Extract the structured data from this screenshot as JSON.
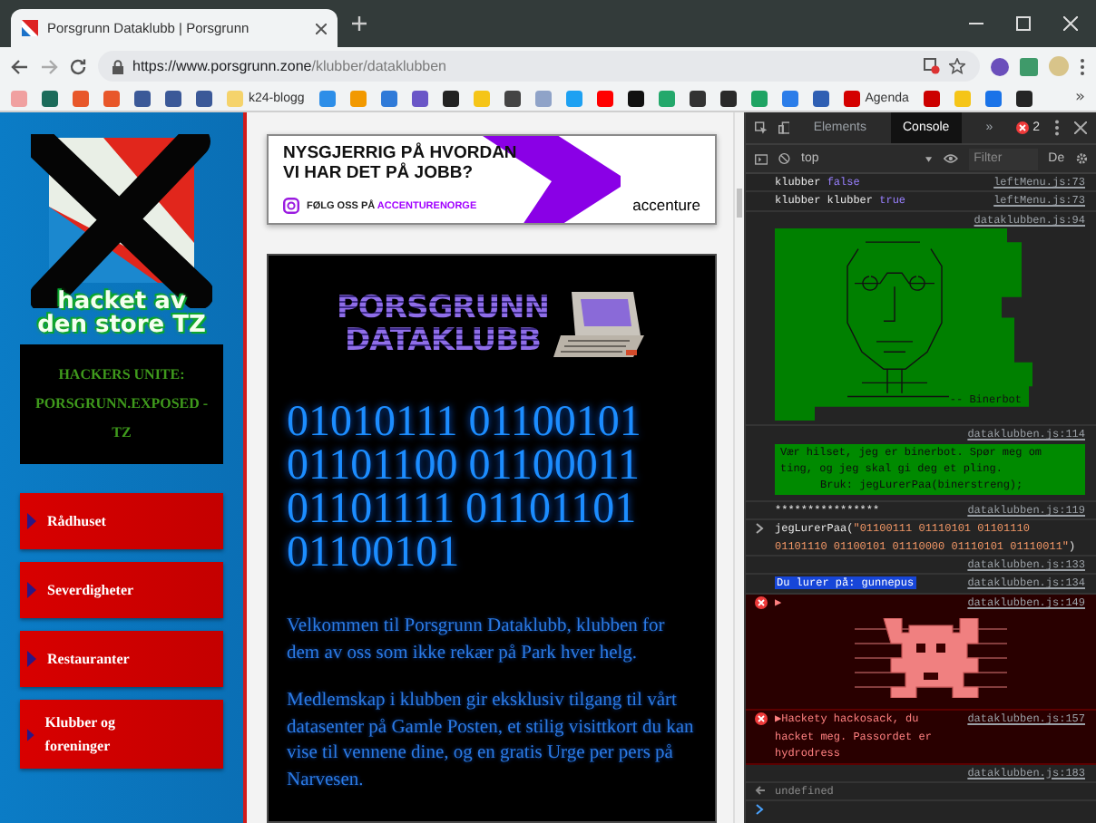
{
  "browser": {
    "tab": {
      "title": "Porsgrunn Dataklubb | Porsgrunn"
    },
    "url": {
      "host": "https://www.porsgrunn.zone",
      "path": "/klubber/dataklubben"
    },
    "bookmarks": [
      {
        "color": "#f0a0a0"
      },
      {
        "color": "#1c6b5a"
      },
      {
        "color": "#e8572a"
      },
      {
        "color": "#e8572a"
      },
      {
        "color": "#3b5998"
      },
      {
        "color": "#3b5998"
      },
      {
        "color": "#3b5998"
      },
      {
        "color": "#f5d36b",
        "label": "k24-blogg"
      },
      {
        "color": "#2d8ee8"
      },
      {
        "color": "#f29900"
      },
      {
        "color": "#2f7ad8"
      },
      {
        "color": "#6a56c7"
      },
      {
        "color": "#222222"
      },
      {
        "color": "#f5c518"
      },
      {
        "color": "#444444"
      },
      {
        "color": "#8fa3c8"
      },
      {
        "color": "#1da1f2"
      },
      {
        "color": "#ff0000"
      },
      {
        "color": "#111111"
      },
      {
        "color": "#23a86b"
      },
      {
        "color": "#333333"
      },
      {
        "color": "#2a2a2a"
      },
      {
        "color": "#1fa463"
      },
      {
        "color": "#2b7de9"
      },
      {
        "color": "#2f5fb3"
      },
      {
        "color": "#d40000",
        "label": "Agenda"
      },
      {
        "color": "#cc0000"
      },
      {
        "color": "#f5c518"
      },
      {
        "color": "#1a73e8"
      },
      {
        "color": "#252525"
      }
    ],
    "bookmarks_overflow": "»"
  },
  "sidebar": {
    "logo_lines": [
      "hacket av",
      "den store TZ"
    ],
    "hackers_box": "HACKERS UNITE: PORSGRUNN.EXPOSED - TZ",
    "menu": [
      {
        "label": "Rådhuset"
      },
      {
        "label": "Severdigheter"
      },
      {
        "label": "Restauranter"
      },
      {
        "label": "Klubber og foreninger"
      }
    ]
  },
  "ad": {
    "headline_lines": [
      "NYSGJERRIG PÅ HVORDAN",
      "VI HAR DET PÅ JOBB?"
    ],
    "follow": "FØLG OSS PÅ",
    "handle": "ACCENTURENORGE",
    "brand": "accenture"
  },
  "club": {
    "logo_lines": [
      "PORSGRUNN",
      "DATAKLUBB"
    ],
    "binary": "01010111 01100101 01101100 01100011 01101111 01101101 01100101",
    "paragraphs": [
      "Velkommen til Porsgrunn Dataklubb, klubben for dem av oss som ikke rekær på Park hver helg.",
      "Medlemskap i klubben gir eksklusiv tilgang til vårt datasenter på Gamle Posten, et stilig visittkort du kan vise til vennene dine, og en gratis Urge per pers på Narvesen."
    ]
  },
  "devtools": {
    "tabs": [
      {
        "label": "Elements",
        "selected": false
      },
      {
        "label": "Console",
        "selected": true
      }
    ],
    "more": "»",
    "error_count": "2",
    "context": "top",
    "filter": {
      "placeholder": "Filter"
    },
    "levels": "De",
    "console": [
      {
        "kind": "log",
        "text": "klubber",
        "value": "false",
        "source": "leftMenu.js:73"
      },
      {
        "kind": "log",
        "text": "klubber klubber",
        "value": "true",
        "source": "leftMenu.js:73"
      },
      {
        "kind": "art",
        "signature": "-- Binerbot",
        "source": "dataklubben.js:94"
      },
      {
        "kind": "banner",
        "lines": [
          "Vær hilset, jeg er binerbot. Spør meg om ting, og jeg skal gi deg et pling.",
          "Bruk: jegLurerPaa(binerstreng);"
        ],
        "source": "dataklubben.js:114"
      },
      {
        "kind": "log",
        "text": "****************",
        "source": "dataklubben.js:119"
      },
      {
        "kind": "input",
        "prefix": "jegLurerPaa(",
        "argument": "\"01100111 01110101 01101110 01101110 01100101 01110000 01110101 01110011\"",
        "suffix": ")"
      },
      {
        "kind": "log",
        "source": "dataklubben.js:133"
      },
      {
        "kind": "highlight",
        "text": "Du lurer på: gunnepus",
        "source": "dataklubben.js:134"
      },
      {
        "kind": "error-art",
        "toggle": "▶",
        "source": "dataklubben.js:149"
      },
      {
        "kind": "error",
        "toggle": "▶",
        "text": "Hackety hackosack, du hacket meg. Passordet er hydrodress",
        "source": "dataklubben.js:157"
      },
      {
        "kind": "log",
        "source": "dataklubben.js:183"
      },
      {
        "kind": "result",
        "text": "undefined"
      },
      {
        "kind": "prompt"
      }
    ]
  }
}
